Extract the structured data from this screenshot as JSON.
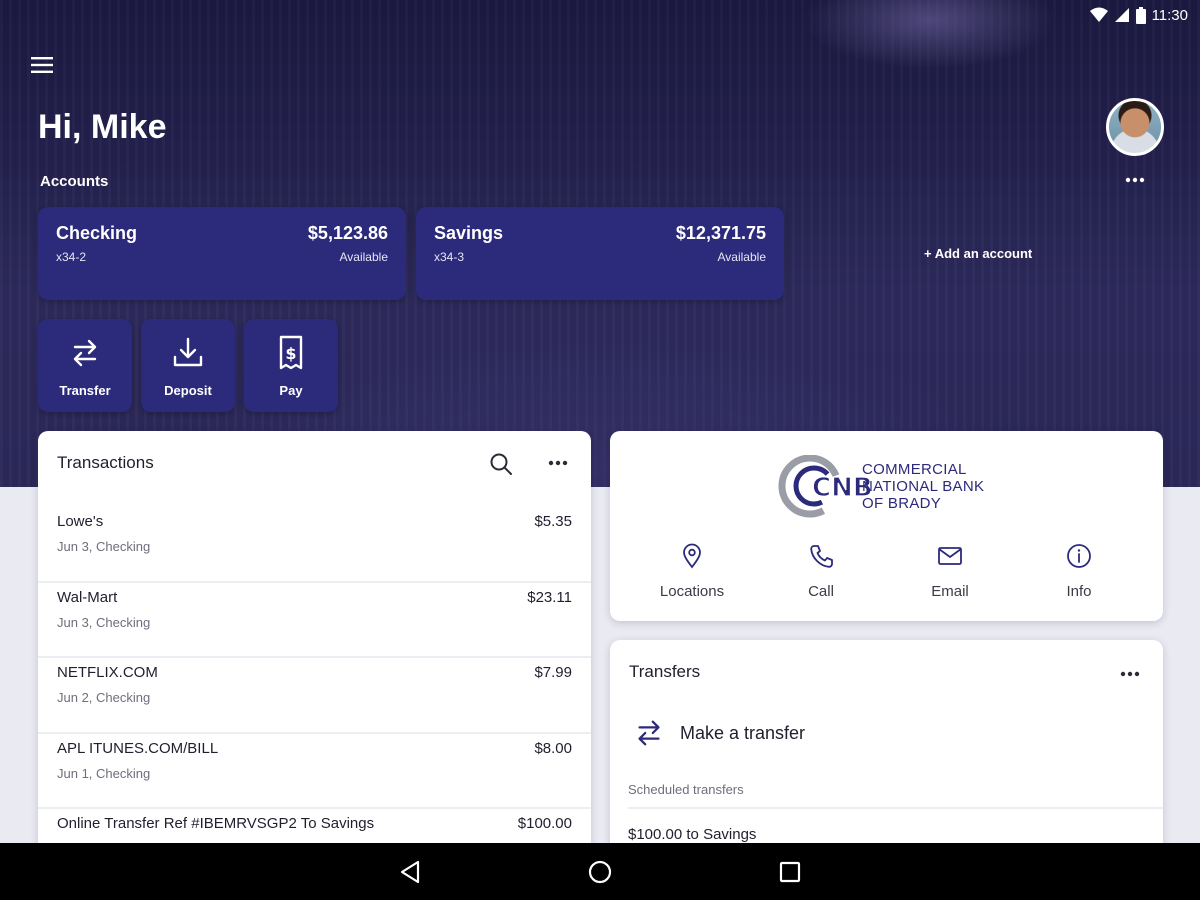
{
  "status_bar": {
    "time": "11:30"
  },
  "header": {
    "greeting": "Hi, Mike",
    "accounts_label": "Accounts"
  },
  "accounts": [
    {
      "name": "Checking",
      "number": "x34-2",
      "balance": "$5,123.86",
      "balance_label": "Available"
    },
    {
      "name": "Savings",
      "number": "x34-3",
      "balance": "$12,371.75",
      "balance_label": "Available"
    }
  ],
  "add_account_label": "+ Add an account",
  "actions": [
    {
      "label": "Transfer",
      "icon": "transfer-icon"
    },
    {
      "label": "Deposit",
      "icon": "deposit-icon"
    },
    {
      "label": "Pay",
      "icon": "pay-icon"
    }
  ],
  "transactions": {
    "title": "Transactions",
    "items": [
      {
        "merchant": "Lowe's",
        "meta": "Jun 3, Checking",
        "amount": "$5.35"
      },
      {
        "merchant": "Wal-Mart",
        "meta": "Jun 3, Checking",
        "amount": "$23.11"
      },
      {
        "merchant": "NETFLIX.COM",
        "meta": "Jun 2, Checking",
        "amount": "$7.99"
      },
      {
        "merchant": "APL ITUNES.COM/BILL",
        "meta": "Jun 1, Checking",
        "amount": "$8.00"
      },
      {
        "merchant": "Online Transfer Ref #IBEMRVSGP2 To Savings",
        "meta": "",
        "amount": "$100.00"
      }
    ]
  },
  "bank": {
    "logo_text": "CNB",
    "name_lines": [
      "COMMERCIAL",
      "NATIONAL BANK",
      "OF BRADY"
    ],
    "contacts": [
      {
        "label": "Locations",
        "icon": "location-pin-icon"
      },
      {
        "label": "Call",
        "icon": "phone-icon"
      },
      {
        "label": "Email",
        "icon": "mail-icon"
      },
      {
        "label": "Info",
        "icon": "info-icon"
      }
    ]
  },
  "transfers": {
    "title": "Transfers",
    "make_transfer_label": "Make a transfer",
    "scheduled_label": "Scheduled transfers",
    "scheduled_items": [
      "$100.00 to Savings"
    ]
  },
  "colors": {
    "brand": "#2c2a7a",
    "hero_background": "#24224e",
    "page_background": "#e9eaf2"
  }
}
